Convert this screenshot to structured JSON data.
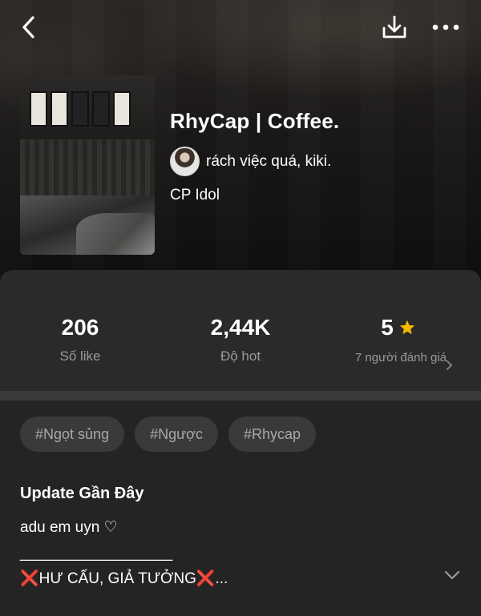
{
  "topbar": {
    "back_icon": "chevron-left-icon",
    "download_icon": "download-icon",
    "more_icon": "more-horizontal-icon"
  },
  "book": {
    "title": "RhyCap | Coffee.",
    "author": "rách việc quá, kiki.",
    "category": "CP Idol"
  },
  "stats": {
    "likes": {
      "value": "206",
      "label": "Số like"
    },
    "hot": {
      "value": "2,44K",
      "label": "Độ hot"
    },
    "rating": {
      "value": "5",
      "sub_label": "7 người đánh giá"
    }
  },
  "tags": [
    "#Ngọt sủng",
    "#Ngược",
    "#Rhycap"
  ],
  "update": {
    "heading": "Update Gần Đây",
    "body": "adu em uyn ♡\n__________________\n❌HƯ CẤU, GIẢ TƯỞNG❌..."
  },
  "colors": {
    "panel": "#2a2a2a",
    "tag_bg": "#3a3a3a",
    "muted_text": "#9a9a9a",
    "star": "#f5b800"
  }
}
